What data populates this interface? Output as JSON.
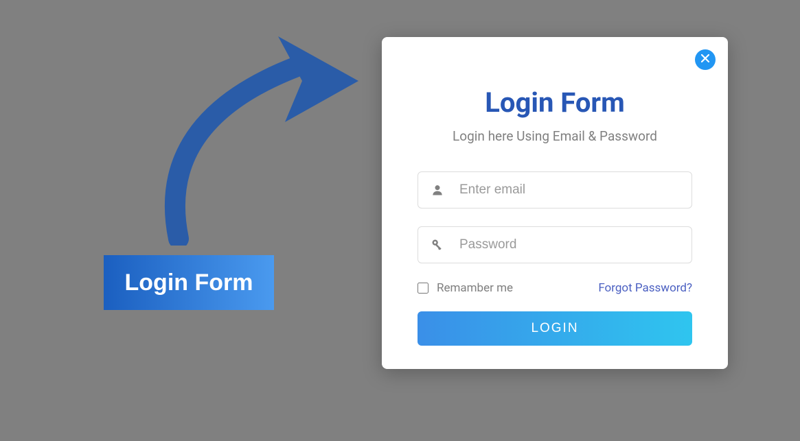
{
  "trigger": {
    "label": "Login Form"
  },
  "modal": {
    "title": "Login Form",
    "subtitle": "Login here Using Email & Password",
    "email_placeholder": "Enter email",
    "password_placeholder": "Password",
    "remember_label": "Remamber me",
    "forgot_label": "Forgot Password?",
    "submit_label": "LOGIN"
  }
}
